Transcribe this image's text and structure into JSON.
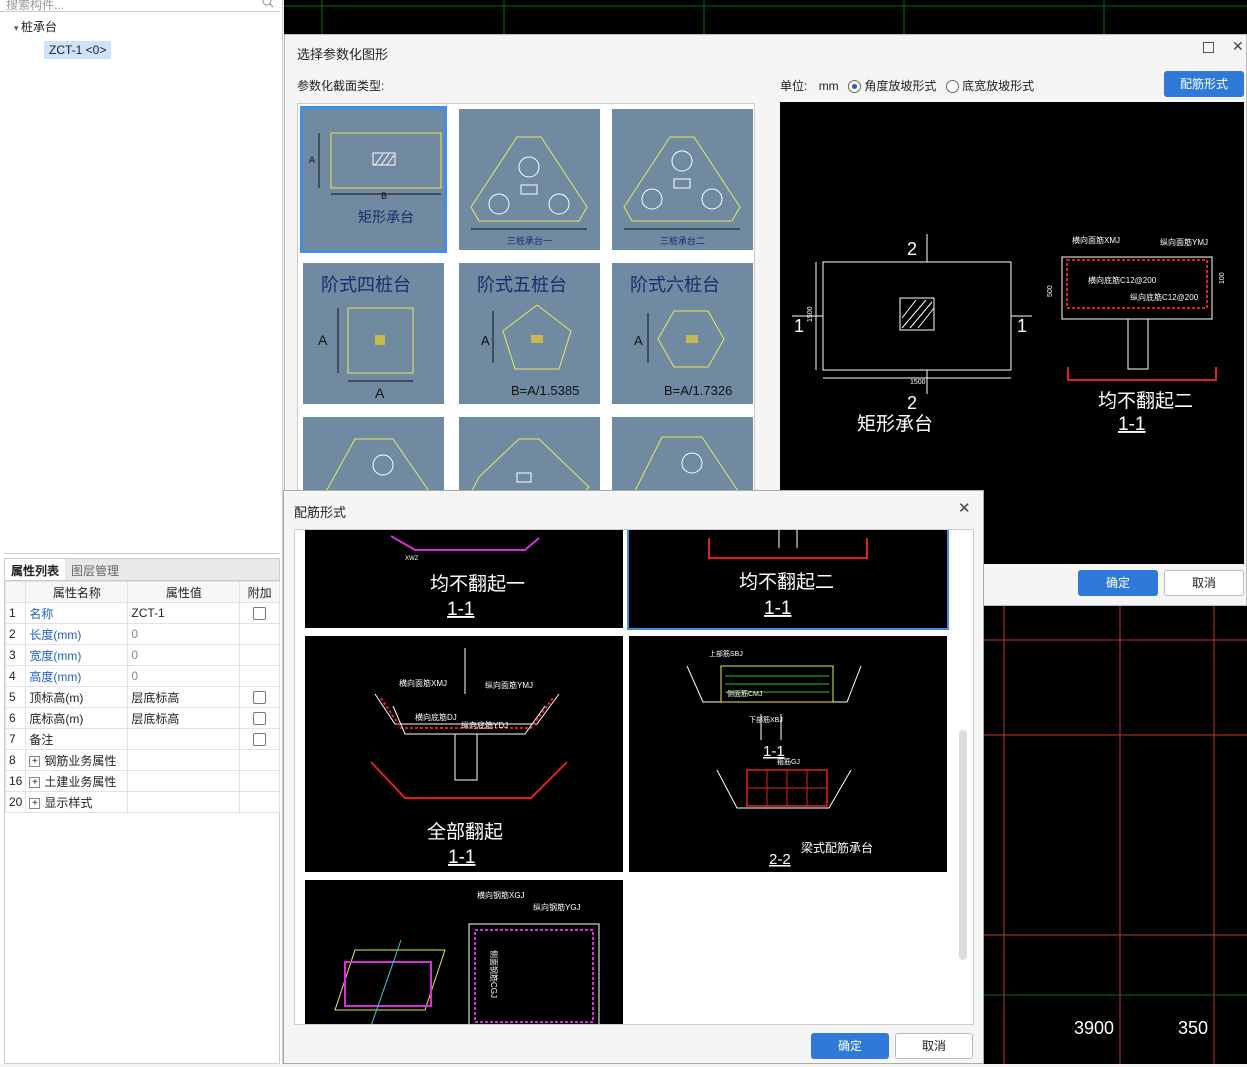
{
  "left_panel": {
    "search_placeholder": "搜索构件...",
    "tree_root": "桩承台",
    "tree_child": "ZCT-1 <0>"
  },
  "props": {
    "tabs": [
      "属性列表",
      "图层管理"
    ],
    "headers": [
      "属性名称",
      "属性值",
      "附加"
    ],
    "rows": [
      {
        "num": "1",
        "name": "名称",
        "value": "ZCT-1"
      },
      {
        "num": "2",
        "name": "长度(mm)",
        "value": "0"
      },
      {
        "num": "3",
        "name": "宽度(mm)",
        "value": "0"
      },
      {
        "num": "4",
        "name": "高度(mm)",
        "value": "0"
      },
      {
        "num": "5",
        "name": "顶标高(m)",
        "value": "层底标高"
      },
      {
        "num": "6",
        "name": "底标高(m)",
        "value": "层底标高"
      },
      {
        "num": "7",
        "name": "备注",
        "value": ""
      },
      {
        "num": "8",
        "name": "钢筋业务属性",
        "value": ""
      },
      {
        "num": "16",
        "name": "土建业务属性",
        "value": ""
      },
      {
        "num": "20",
        "name": "显示样式",
        "value": ""
      }
    ]
  },
  "dialog1": {
    "title": "选择参数化图形",
    "section_label": "参数化截面类型:",
    "unit_label": "单位:",
    "unit_value": "mm",
    "radio1": "角度放坡形式",
    "radio2": "底宽放坡形式",
    "rebar_button": "配筋形式",
    "ok": "确定",
    "cancel": "取消",
    "thumbs": {
      "t1": "矩形承台",
      "t2": "三桩承台一",
      "t3": "三桩承台二",
      "t4": "阶式四桩台",
      "t5": "阶式五桩台",
      "t6": "阶式六桩台",
      "t5_formula": "B=A/1.5385",
      "t6_formula": "B=A/1.7326"
    },
    "preview": {
      "section_mark": "2",
      "side_mark": "1",
      "dim_w": "1500",
      "dim_h": "1500",
      "title": "矩形承台",
      "right_title": "均不翻起二",
      "right_sub": "1-1",
      "lab_top1": "横向面筋XMJ",
      "lab_top2": "纵向面筋YMJ",
      "lab_bot1": "横向底筋C12@200",
      "lab_bot2": "纵向底筋C12@200",
      "dim_500": "500",
      "dim_100": "100"
    }
  },
  "dialog2": {
    "title": "配筋形式",
    "ok": "确定",
    "cancel": "取消",
    "cards": {
      "c1": "均不翻起一",
      "c1_sub": "1-1",
      "c2": "均不翻起二",
      "c2_sub": "1-1",
      "c3": "全部翻起",
      "c3_sub": "1-1",
      "c3_l1": "横向面筋XMJ",
      "c3_l2": "纵向面筋YMJ",
      "c3_l3": "横向底筋DJ",
      "c3_l4": "纵向底筋YDJ",
      "c4_title": "梁式配筋承台",
      "c4_sub1": "1-1",
      "c4_sub2": "2-2",
      "c4_l1": "上部筋SBJ",
      "c4_l2": "侧面筋CMJ",
      "c4_l3": "下部筋XBJ",
      "c4_l4": "箍筋GJ",
      "c5_l1": "横向钢筋XGJ",
      "c5_l2": "纵向钢筋YGJ",
      "c5_l3": "侧面钢筋CGJ"
    }
  },
  "background": {
    "dim1": "3900",
    "dim2": "350"
  }
}
